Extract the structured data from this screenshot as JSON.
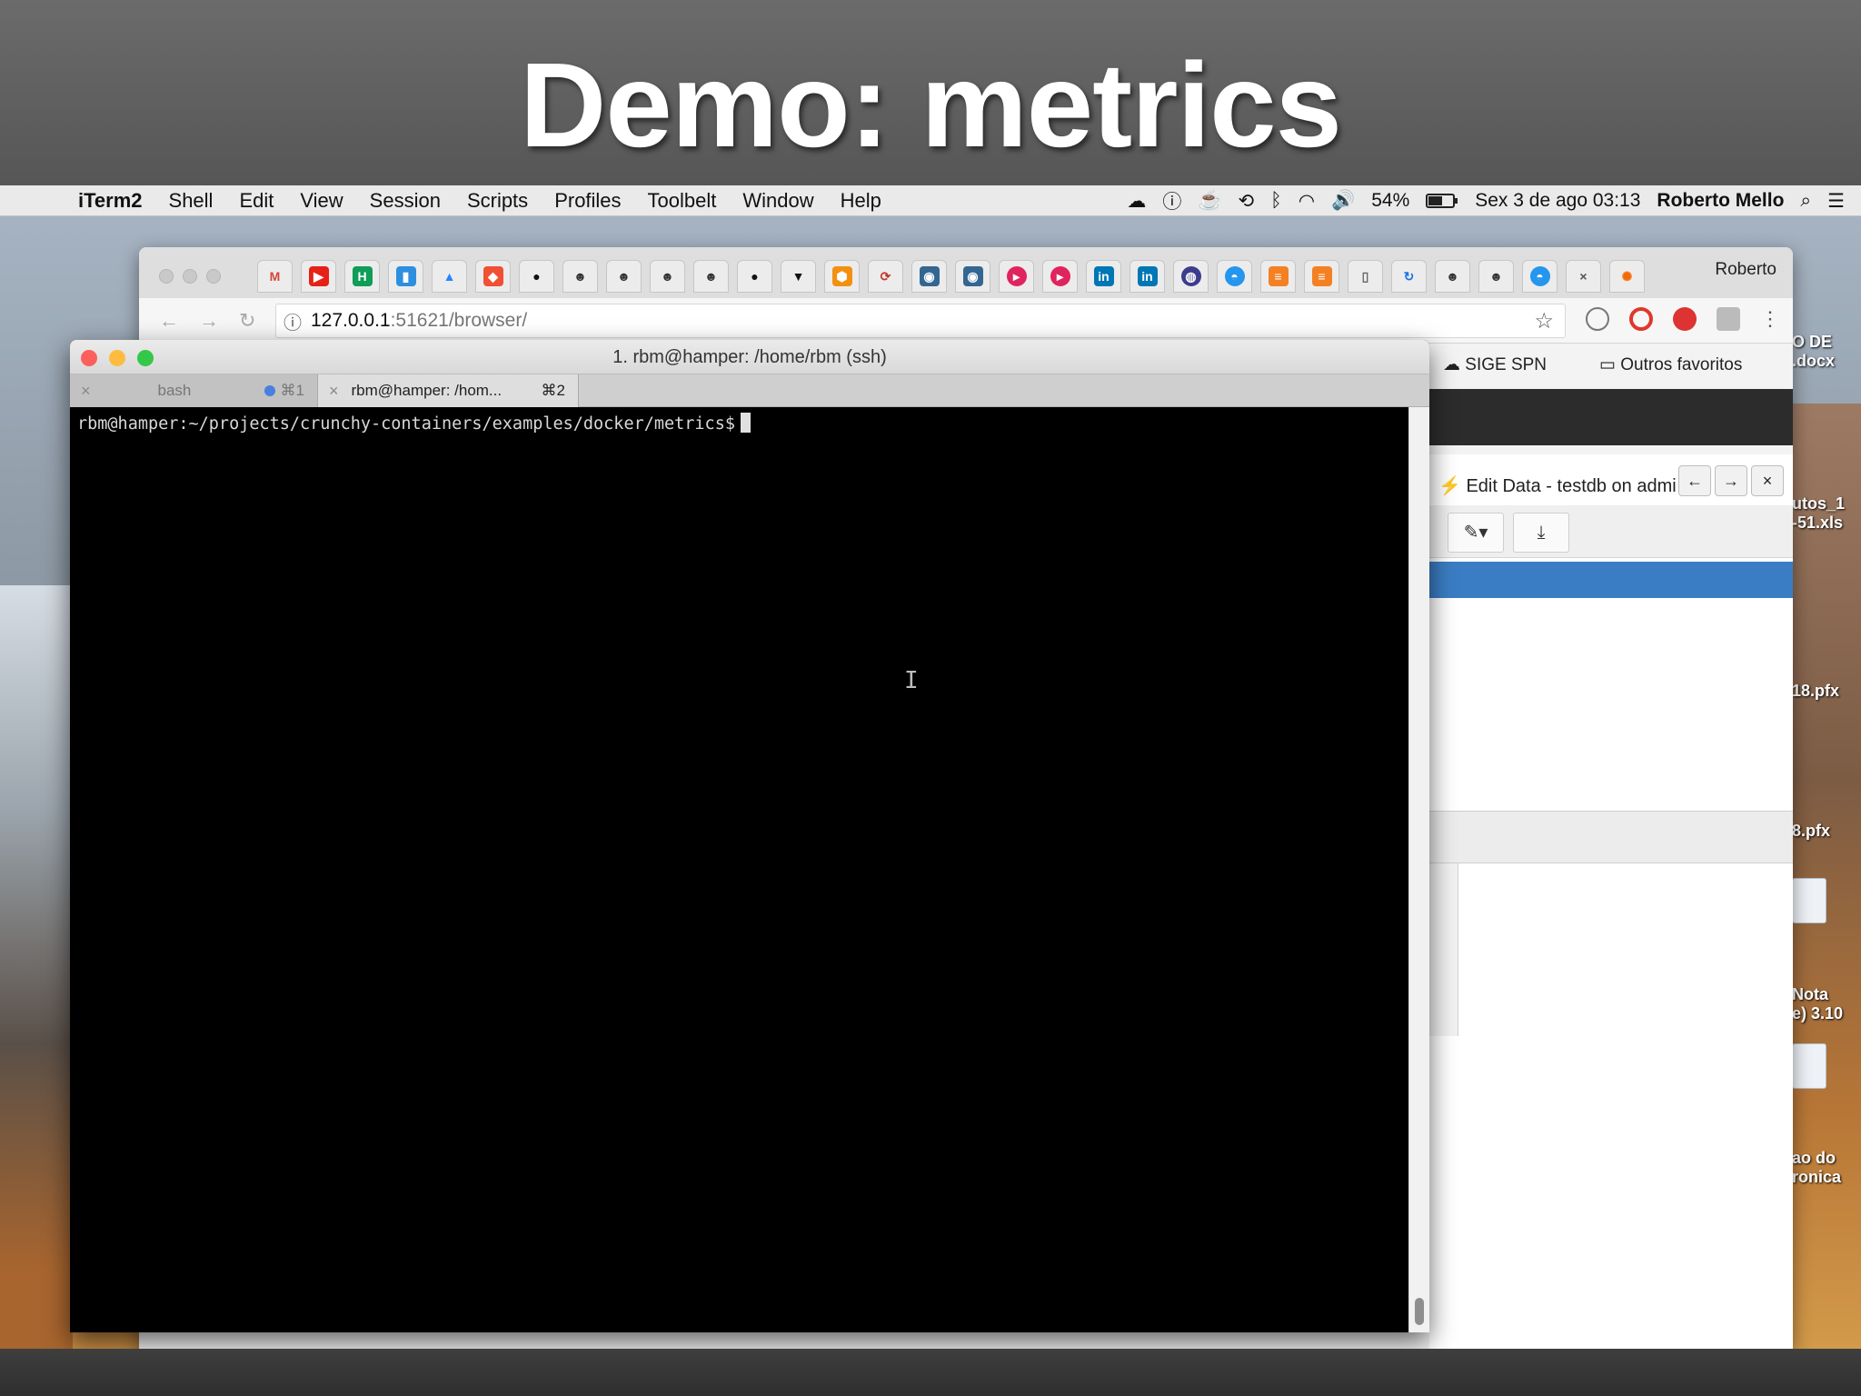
{
  "slide": {
    "title": "Demo: metrics"
  },
  "menubar": {
    "app": "iTerm2",
    "items": [
      "Shell",
      "Edit",
      "View",
      "Session",
      "Scripts",
      "Profiles",
      "Toolbelt",
      "Window",
      "Help"
    ],
    "battery_percent": "54%",
    "datetime": "Sex 3 de ago  03:13",
    "user": "Roberto Mello"
  },
  "browser": {
    "profile": "Roberto",
    "url_host": "127.0.0.1",
    "url_path": ":51621/browser/",
    "bookmarks": [
      "SIGE SPN",
      "Outros favoritos"
    ],
    "panel": {
      "title": "Edit Data - testdb on admi"
    }
  },
  "iterm": {
    "window_title": "1. rbm@hamper: /home/rbm (ssh)",
    "tabs": [
      {
        "label": "bash",
        "shortcut": "⌘1"
      },
      {
        "label": "rbm@hamper: /hom...",
        "shortcut": "⌘2"
      }
    ],
    "prompt": "rbm@hamper:~/projects/crunchy-containers/examples/docker/metrics$"
  },
  "desktop": {
    "files": [
      "O DE",
      ".docx",
      "utos_1",
      "-51.xls",
      "18.pfx",
      "8.pfx",
      "Nota",
      "e) 3.10",
      "ao do",
      "ronica"
    ]
  },
  "colors": {
    "terminal_bg": "#000000",
    "selection_blue": "#3b7dc4",
    "traffic_red": "#fc605c",
    "traffic_yellow": "#fdbc40",
    "traffic_green": "#34c84a"
  }
}
